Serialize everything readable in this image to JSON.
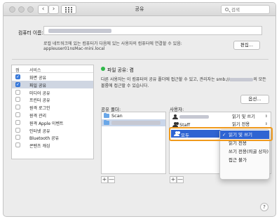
{
  "window": {
    "title": "공유"
  },
  "search": {
    "placeholder": "검색"
  },
  "computer_name": {
    "label": "컴퓨터 이름:",
    "desc_line1": "로컬 네트워크에 있는 컴퓨터가 다음에 있는 사용자의 컴퓨터에 연결할 수 있음:",
    "local_host": "appleuser01nsMac-mini.local",
    "edit_button": "편집..."
  },
  "services": {
    "header_on": "켬",
    "header_service": "서비스",
    "items": [
      {
        "label": "화면 공유",
        "checked": true,
        "selected": false
      },
      {
        "label": "파일 공유",
        "checked": true,
        "selected": true
      },
      {
        "label": "미디어 공유",
        "checked": false,
        "selected": false
      },
      {
        "label": "프린터 공유",
        "checked": false,
        "selected": false
      },
      {
        "label": "원격 로그인",
        "checked": false,
        "selected": false
      },
      {
        "label": "원격 관리",
        "checked": false,
        "selected": false
      },
      {
        "label": "원격 Apple 이벤트",
        "checked": false,
        "selected": false
      },
      {
        "label": "인터넷 공유",
        "checked": false,
        "selected": false
      },
      {
        "label": "Bluetooth 공유",
        "checked": false,
        "selected": false
      },
      {
        "label": "콘텐츠 캐싱",
        "checked": false,
        "selected": false
      }
    ]
  },
  "status": {
    "text": "파일 공유: 켬",
    "color": "#2fb84a",
    "desc_line1": "다른 사용자는 이 컴퓨터의 공유 폴더에 접근할 수 있고, 관리자는 smb://",
    "desc_line1_end": "의 모든",
    "desc_line2": "볼륨에 접근할 수 있습니다."
  },
  "options_button": "옵션...",
  "shared_folders": {
    "label": "공유 폴더:",
    "items": [
      {
        "name": "Scan",
        "selected": false
      },
      {
        "name": "",
        "selected": true
      }
    ]
  },
  "users": {
    "label": "사용자:",
    "rows": [
      {
        "name": "",
        "permission": "읽기 및 쓰기"
      },
      {
        "name": "Staff",
        "permission": "읽기 전용"
      },
      {
        "name": "모두",
        "permission": "읽기 및 쓰기"
      }
    ]
  },
  "permission_menu": {
    "items": [
      {
        "label": "읽기 및 쓰기",
        "checked": true
      },
      {
        "label": "읽기 전용",
        "checked": false
      },
      {
        "label": "쓰기 전용(띄굴 상자)",
        "checked": false
      },
      {
        "label": "접근 불가",
        "checked": false
      }
    ]
  },
  "add_label": "+",
  "remove_label": "—",
  "help_label": "?",
  "highlight_color": "#f09a1c",
  "accent_color": "#2f64d2"
}
